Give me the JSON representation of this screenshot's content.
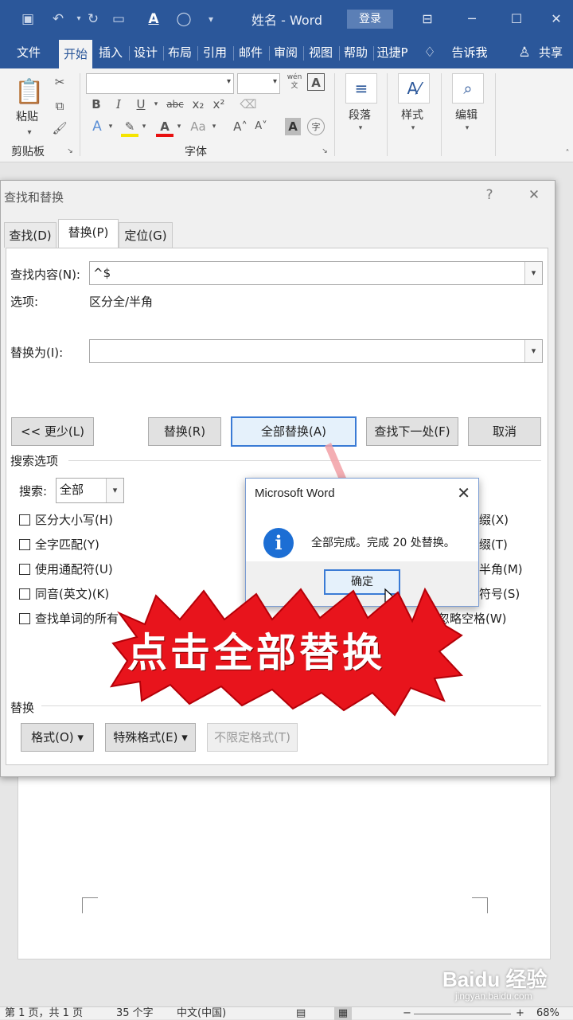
{
  "window": {
    "doc_title": "姓名 - Word",
    "login_label": "登录"
  },
  "ribbon_tabs": [
    "文件",
    "开始",
    "插入",
    "设计",
    "布局",
    "引用",
    "邮件",
    "审阅",
    "视图",
    "帮助",
    "迅捷P"
  ],
  "tell_me": "告诉我",
  "share": "共享",
  "ribbon": {
    "paste_label": "粘贴",
    "clipboard_group": "剪贴板",
    "font_group": "字体",
    "bold": "B",
    "italic": "I",
    "underline": "U",
    "strike": "abc",
    "sub": "x₂",
    "sup": "x²",
    "font_color_letter": "A",
    "aa_letters": "Aa",
    "paragraph_label": "段落",
    "styles_label": "样式",
    "edit_label": "编辑",
    "wen": "wén 文"
  },
  "dialog": {
    "title": "查找和替换",
    "help": "?",
    "tabs": [
      "查找(D)",
      "替换(P)",
      "定位(G)"
    ],
    "find_label": "查找内容(N):",
    "find_value": "^$",
    "options_label": "选项:",
    "options_value": "区分全/半角",
    "replace_label": "替换为(I):",
    "replace_value": "",
    "less_button": "<< 更少(L)",
    "replace_button": "替换(R)",
    "replace_all_button": "全部替换(A)",
    "find_next_button": "查找下一处(F)",
    "cancel_button": "取消",
    "search_options_header": "搜索选项",
    "search_label": "搜索:",
    "search_value": "全部",
    "left_checks": [
      "区分大小写(H)",
      "全字匹配(Y)",
      "使用通配符(U)",
      "同音(英文)(K)",
      "查找单词的所有"
    ],
    "right_checks": [
      "缀(X)",
      "缀(T)",
      "半角(M)",
      "符号(S)",
      "忽略空格(W)"
    ],
    "replace_section_header": "替换",
    "format_button": "格式(O) ▾",
    "special_button": "特殊格式(E) ▾",
    "no_format_button": "不限定格式(T)"
  },
  "message_box": {
    "title": "Microsoft Word",
    "text": "全部完成。完成 20 处替换。",
    "ok": "确定"
  },
  "banner": "点击全部替换",
  "watermark": {
    "main": "Baidu 经验",
    "sub": "jingyan.baidu.com"
  },
  "statusbar": {
    "page": "第 1 页，共 1 页",
    "words": "35 个字",
    "lang": "中文(中国)",
    "zoom": "68%"
  },
  "colors": {
    "accent": "#2b579a",
    "banner_red": "#e8141c",
    "info_blue": "#1c6ed4"
  }
}
